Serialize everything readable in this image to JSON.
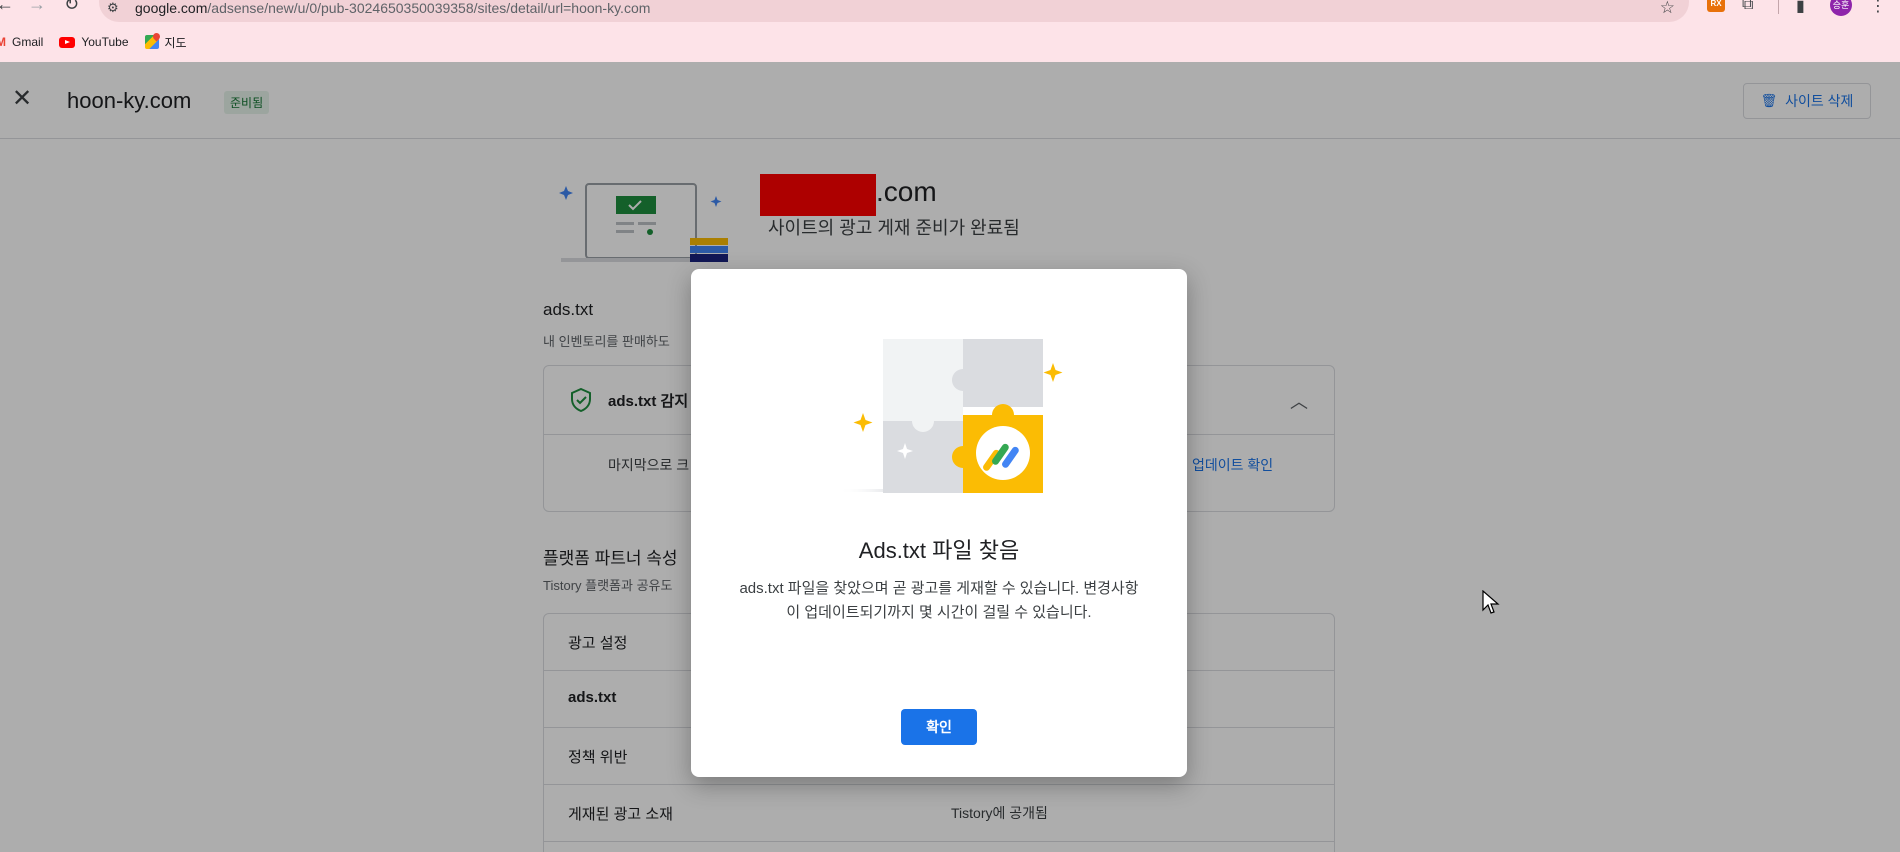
{
  "browser": {
    "url_main": "google.com",
    "url_rest": "/adsense/new/u/0/pub-3024650350039358/sites/detail/url=hoon-ky.com",
    "bookmarks": [
      {
        "label": "Gmail",
        "icon": "gmail-icon"
      },
      {
        "label": "YouTube",
        "icon": "youtube-icon"
      },
      {
        "label": "지도",
        "icon": "maps-icon"
      }
    ],
    "profile_initials": "승훈",
    "extension_badge": "RX"
  },
  "header": {
    "site": "hoon-ky.com",
    "status_chip": "준비됨",
    "delete_label": "사이트 삭제"
  },
  "hero": {
    "domain_suffix": ".com",
    "subtitle": "사이트의 광고 게재 준비가 완료됨"
  },
  "ads_section": {
    "title": "ads.txt",
    "desc": "내 인벤토리를 판매하도",
    "detect_label": "ads.txt 감지",
    "last_crawl": "마지막으로 크",
    "check_update": "업데이트 확인"
  },
  "platform_section": {
    "title": "플랫폼 파트너 속성",
    "desc": "Tistory 플랫폼과 공유도",
    "rows": [
      {
        "label": "광고 설정",
        "value": ""
      },
      {
        "label": "ads.txt",
        "value": ""
      },
      {
        "label": "정책 위반",
        "value": ""
      },
      {
        "label": "게재된 광고 소재",
        "value": "Tistory에 공개됨"
      }
    ]
  },
  "dialog": {
    "title": "Ads.txt 파일 찾음",
    "body": "ads.txt 파일을 찾았으며 곧 광고를 게재할 수 있습니다. 변경사항이 업데이트되기까지 몇 시간이 걸릴 수 있습니다.",
    "ok_label": "확인"
  },
  "colors": {
    "accent": "#1a73e8",
    "adsense_yellow": "#fbbc04",
    "redaction": "#ff0000",
    "chrome_bg": "#fde3e8"
  }
}
